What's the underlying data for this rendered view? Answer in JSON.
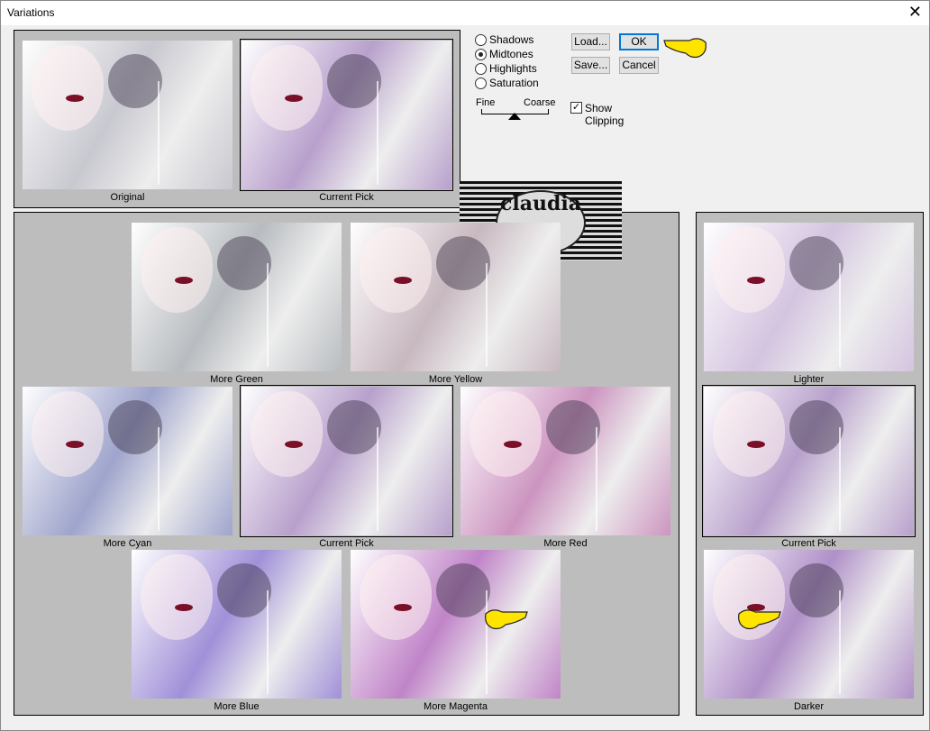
{
  "window": {
    "title": "Variations",
    "close_icon": "close-icon"
  },
  "top": {
    "original_label": "Original",
    "current_pick_label": "Current Pick"
  },
  "controls": {
    "radios": [
      {
        "label": "Shadows",
        "checked": false
      },
      {
        "label": "Midtones",
        "checked": true
      },
      {
        "label": "Highlights",
        "checked": false
      },
      {
        "label": "Saturation",
        "checked": false
      }
    ],
    "slider": {
      "fine_label": "Fine",
      "coarse_label": "Coarse",
      "level_index": 3,
      "ticks": 7
    },
    "load_label": "Load...",
    "save_label": "Save...",
    "ok_label": "OK",
    "cancel_label": "Cancel",
    "show_clipping_label": "Show Clipping",
    "show_clipping_checked": true
  },
  "watermark": {
    "text": "claudia"
  },
  "colors": {
    "green": "#b8bcc0",
    "yellow": "#c8b8c0",
    "cyan": "#9ea4cc",
    "current": "#b8a0cc",
    "red": "#cc94c0",
    "blue": "#a090d8",
    "magenta": "#c084c8",
    "lighter": "#d4c4e0",
    "darker": "#b090c8",
    "original": "#c8c8d0"
  },
  "variations": [
    {
      "key": "green",
      "label": "More Green"
    },
    {
      "key": "yellow",
      "label": "More Yellow"
    },
    {
      "key": "cyan",
      "label": "More Cyan"
    },
    {
      "key": "current",
      "label": "Current Pick"
    },
    {
      "key": "red",
      "label": "More Red"
    },
    {
      "key": "blue",
      "label": "More Blue"
    },
    {
      "key": "magenta",
      "label": "More Magenta"
    }
  ],
  "brightness": [
    {
      "key": "lighter",
      "label": "Lighter"
    },
    {
      "key": "current",
      "label": "Current Pick"
    },
    {
      "key": "darker",
      "label": "Darker"
    }
  ]
}
